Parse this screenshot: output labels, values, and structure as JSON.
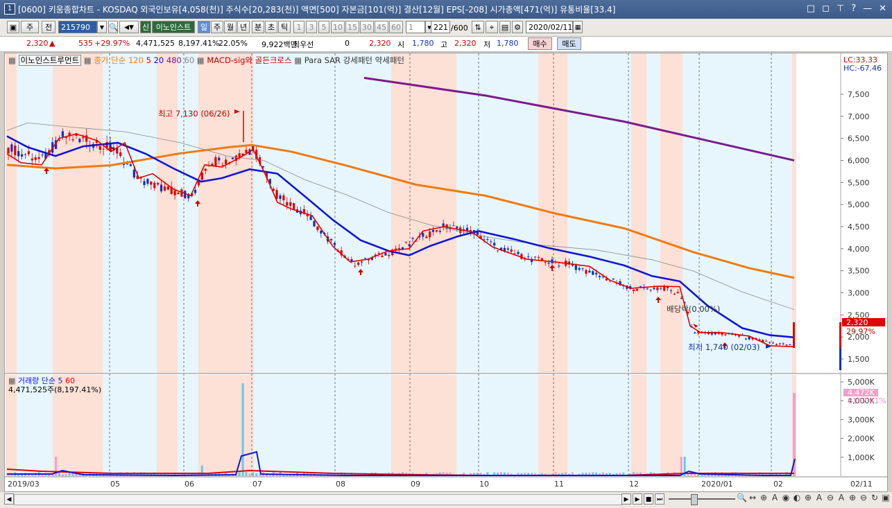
{
  "window": {
    "number": "1",
    "title": "[0600] 키움종합차트 - KOSDAQ 외국인보유[4,058(천)] 주식수[20,283(천)] 액면[500] 자본금[101(억)] 결산[12월] EPS[-208] 시가총액[471(억)] 유통비율[33.4]",
    "icons": [
      "□",
      "◻",
      "⊤",
      "?",
      "—",
      "✕"
    ]
  },
  "toolbar": {
    "period_label": "주",
    "type_label": "전",
    "code": "215790",
    "name_badge": "신",
    "name": "이노인스트",
    "periods": [
      "일",
      "주",
      "월",
      "년",
      "분",
      "초",
      "틱"
    ],
    "selected_period": "일",
    "minutes": [
      "1",
      "3",
      "5",
      "10",
      "15",
      "30",
      "45",
      "60"
    ],
    "count_value": "1",
    "range": "221",
    "range_max": "/600",
    "date": "2020/02/11"
  },
  "infobar": {
    "price": "2,320",
    "change": "535",
    "change_pct": "+29.97%",
    "volume": "4,471,525",
    "volume_ratio": "8,197.41%",
    "turnover": "22.05%",
    "amount": "9,922백만",
    "pref_label": "최우선",
    "pref_value": "0",
    "quote": "2,320",
    "open_label": "시",
    "open": "1,780",
    "high_label": "고",
    "high": "2,320",
    "low_label": "저",
    "low": "1,780",
    "buy": "매수",
    "sell": "매도"
  },
  "legend": {
    "stock": "이노인스트루먼트",
    "ma": "종가 단순 120",
    "ma5": "5",
    "ma20": "20",
    "ma480": "480",
    "ma60": "60",
    "macd": "MACD-sig와 골든크로스",
    "psar": "Para SAR 강세패턴",
    "weak": "약세패턴"
  },
  "right_labels": {
    "lc": "LC:33.33",
    "hc": "HC:-67.46",
    "last_price": "2,320",
    "last_pct": "29.97%",
    "vol_last": "4,472K",
    "vol_pct": "8197.41%"
  },
  "annotations": {
    "high": "최고 7,130 (06/26)",
    "low": "최저 1,740 (02/03)",
    "dividend": "배당락(0.00%)"
  },
  "volume_legend": {
    "title": "거래량",
    "ma": "단순 5",
    "ma60": "60",
    "value": "4,471,525주(8,197.41%)"
  },
  "chart_data": {
    "type": "line",
    "price_axis": [
      "7,500",
      "7,000",
      "6,500",
      "6,000",
      "5,500",
      "5,000",
      "4,500",
      "4,000",
      "3,500",
      "3,000",
      "2,500",
      "2,000",
      "1,500"
    ],
    "volume_axis": [
      "5,000K",
      "4,000K",
      "3,000K",
      "2,000K",
      "1,000K"
    ],
    "x_ticks": [
      "2019/03",
      "05",
      "06",
      "07",
      "08",
      "09",
      "10",
      "11",
      "12",
      "2020/01",
      "02"
    ],
    "last_date": "02/11",
    "series": [
      {
        "name": "5",
        "color": "#e00000"
      },
      {
        "name": "20",
        "color": "#1414d2"
      },
      {
        "name": "120",
        "color": "#f07a10"
      },
      {
        "name": "480",
        "color": "#7a1a8c"
      },
      {
        "name": "60",
        "color": "#8a8a8a"
      }
    ],
    "ylim": [
      1300,
      8000
    ]
  },
  "bottombar": {
    "buttons": [
      "▶",
      "■",
      "⏭"
    ],
    "tools": [
      "🔍",
      "↔",
      "⊕",
      "A",
      "◉",
      "◐",
      "⊕",
      "A",
      "⊖",
      "A",
      "⊕",
      "⊖",
      "↻",
      "▣"
    ]
  }
}
